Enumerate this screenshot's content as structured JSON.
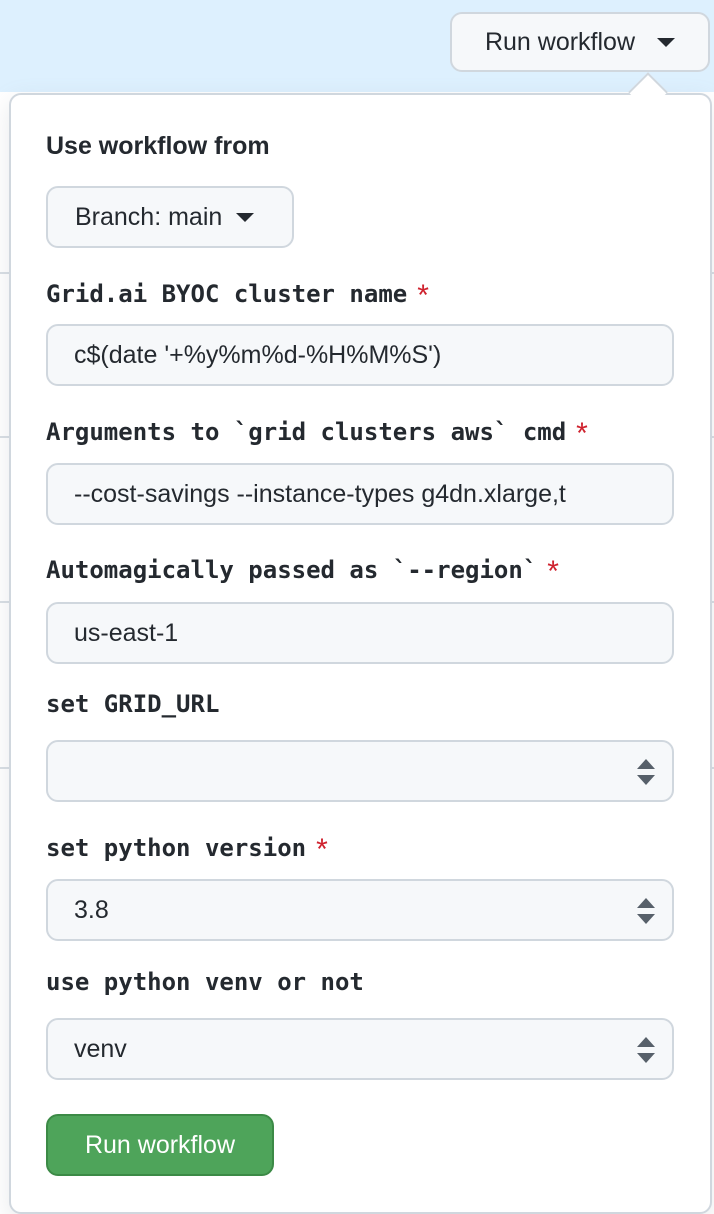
{
  "header": {
    "run_workflow_label": "Run workflow"
  },
  "popover": {
    "use_workflow_from_label": "Use workflow from",
    "branch_button_label": "Branch: main",
    "fields": [
      {
        "label": "Grid.ai BYOC cluster name",
        "required": true,
        "value": "c$(date '+%y%m%d-%H%M%S')"
      },
      {
        "label": "Arguments to `grid clusters aws` cmd",
        "required": true,
        "value": "--cost-savings --instance-types g4dn.xlarge,t"
      },
      {
        "label": "Automagically passed as `--region`",
        "required": true,
        "value": "us-east-1"
      }
    ],
    "selects": [
      {
        "label": "set GRID_URL",
        "required": false,
        "value": ""
      },
      {
        "label": "set python version",
        "required": true,
        "value": "3.8"
      },
      {
        "label": "use python venv or not",
        "required": false,
        "value": "venv"
      }
    ],
    "required_marker": "*",
    "submit_label": "Run workflow"
  },
  "colors": {
    "banner": "#ddf0fe",
    "submit_green": "#4ea45a",
    "required_red": "#cf222e",
    "border": "#d0d7de",
    "field_bg": "#f6f8fa"
  }
}
